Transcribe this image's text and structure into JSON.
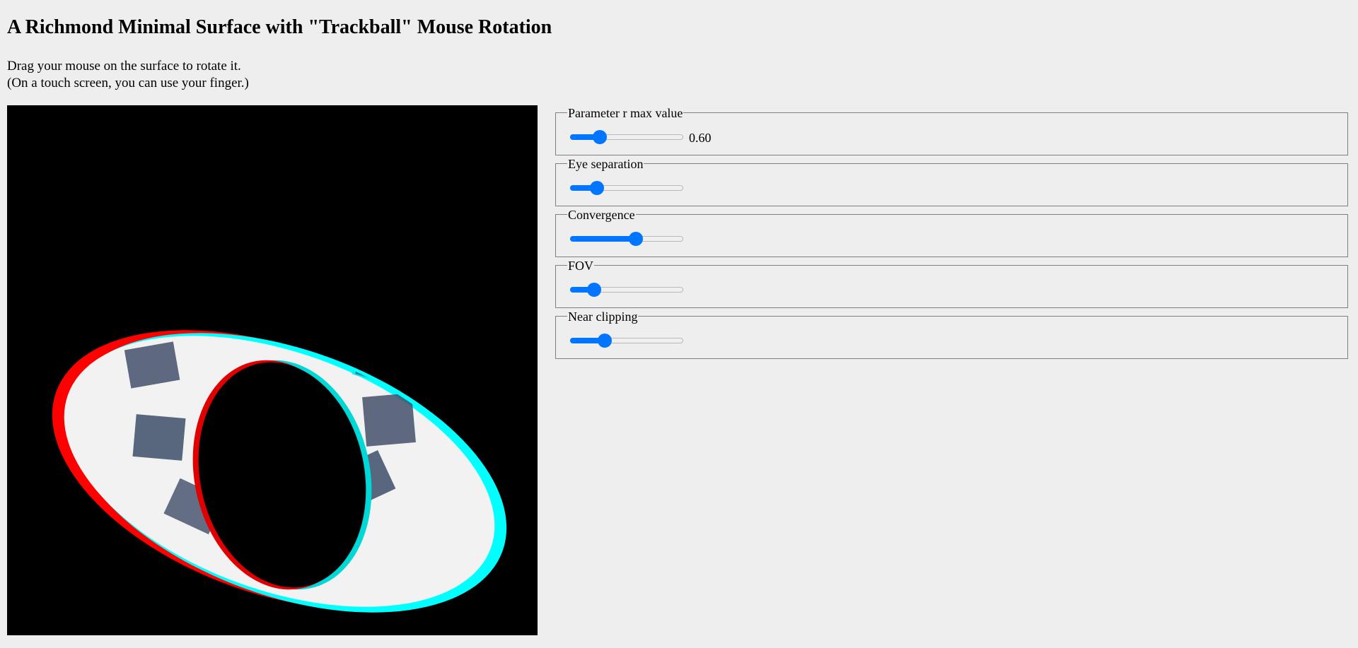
{
  "header": {
    "title": "A Richmond Minimal Surface with \"Trackball\" Mouse Rotation",
    "instruction_1": "Drag your mouse on the surface to rotate it.",
    "instruction_2": "(On a touch screen, you can use your finger.)"
  },
  "canvas": {
    "background": "#000000",
    "description_colors": {
      "left_eye": "#ff0000",
      "right_eye": "#00ffff",
      "surface": "#f2f2f2"
    }
  },
  "controls": [
    {
      "label": "Parameter r max value",
      "value_fraction": 0.23,
      "value_text": "0.60"
    },
    {
      "label": "Eye separation",
      "value_fraction": 0.2,
      "value_text": ""
    },
    {
      "label": "Convergence",
      "value_fraction": 0.59,
      "value_text": ""
    },
    {
      "label": "FOV",
      "value_fraction": 0.17,
      "value_text": ""
    },
    {
      "label": "Near clipping",
      "value_fraction": 0.28,
      "value_text": ""
    }
  ],
  "colors": {
    "accent": "#0075ff",
    "page_background": "#eeeeee"
  }
}
